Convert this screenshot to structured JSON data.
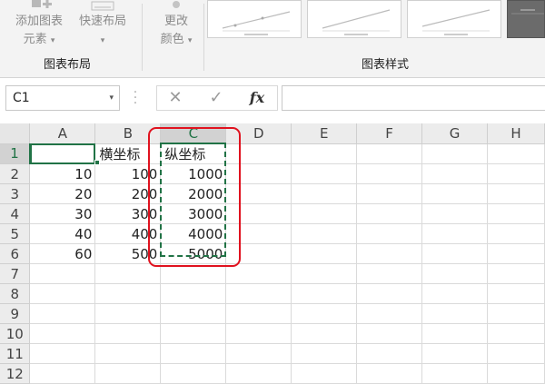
{
  "ribbon": {
    "add_element": {
      "line1": "添加图表",
      "line2": "元素"
    },
    "quick_layout": {
      "line1": "快速布局",
      "line2": ""
    },
    "change_color": {
      "line1": "更改",
      "line2": "颜色"
    },
    "group_chart_layout": "图表布局",
    "group_chart_styles": "图表样式",
    "colors": {
      "accent": "#217346",
      "highlight": "#e0121f"
    }
  },
  "formula_bar": {
    "name_box": "C1",
    "cancel_icon": "✕",
    "enter_icon": "✓",
    "fx_label": "fx",
    "formula": ""
  },
  "sheet": {
    "columns": [
      "A",
      "B",
      "C",
      "D",
      "E",
      "F",
      "G",
      "H"
    ],
    "rows": [
      {
        "n": "1",
        "A": "",
        "B": "横坐标",
        "C": "纵坐标"
      },
      {
        "n": "2",
        "A": "10",
        "B": "100",
        "C": "1000"
      },
      {
        "n": "3",
        "A": "20",
        "B": "200",
        "C": "2000"
      },
      {
        "n": "4",
        "A": "30",
        "B": "300",
        "C": "3000"
      },
      {
        "n": "5",
        "A": "40",
        "B": "400",
        "C": "4000"
      },
      {
        "n": "6",
        "A": "60",
        "B": "500",
        "C": "5000"
      },
      {
        "n": "7",
        "A": "",
        "B": "",
        "C": ""
      },
      {
        "n": "8",
        "A": "",
        "B": "",
        "C": ""
      },
      {
        "n": "9",
        "A": "",
        "B": "",
        "C": ""
      },
      {
        "n": "10",
        "A": "",
        "B": "",
        "C": ""
      },
      {
        "n": "11",
        "A": "",
        "B": "",
        "C": ""
      },
      {
        "n": "12",
        "A": "",
        "B": "",
        "C": ""
      }
    ]
  }
}
